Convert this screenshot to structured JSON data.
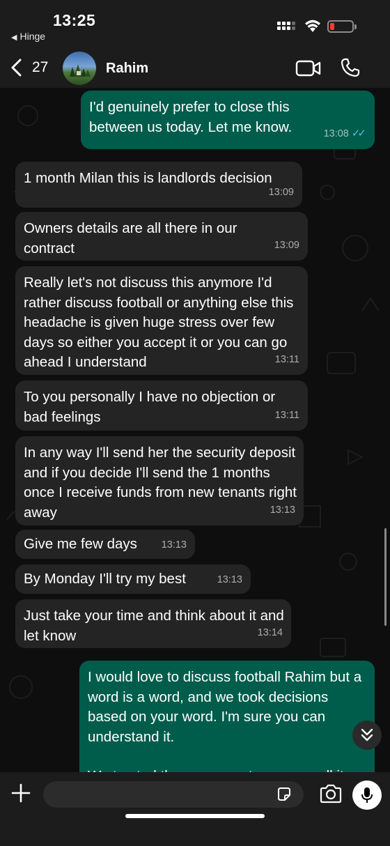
{
  "status_bar": {
    "time": "13:25",
    "back_app": "Hinge"
  },
  "header": {
    "back_count": "27",
    "contact_name": "Rahim"
  },
  "messages": [
    {
      "direction": "out",
      "text": "I'd genuinely prefer to close this between us today. Let me know.",
      "time": "13:08",
      "read": true
    },
    {
      "direction": "in",
      "text": "1 month Milan this is landlords decision",
      "time": "13:09"
    },
    {
      "direction": "in",
      "text": "Owners details are all there in our contract",
      "time": "13:09"
    },
    {
      "direction": "in",
      "text": "Really let's not discuss this anymore I'd rather discuss football or anything else this headache is given huge stress over few days so either you accept it or you can go ahead I understand",
      "time": "13:11"
    },
    {
      "direction": "in",
      "text": "To you personally I have no objection or bad feelings",
      "time": "13:11"
    },
    {
      "direction": "in",
      "text": "In any way I'll send her the security deposit and if you decide I'll send the 1 months once I receive funds from new tenants right away",
      "time": "13:13"
    },
    {
      "direction": "in",
      "text": "Give me few days",
      "time": "13:13"
    },
    {
      "direction": "in",
      "text": "By Monday I'll try my best",
      "time": "13:13"
    },
    {
      "direction": "in",
      "text": "Just take your time and think about it and let know",
      "time": "13:14"
    },
    {
      "direction": "out",
      "text": "I would love to discuss football Rahim but a word is a word, and we took decisions based on your word. I'm sure you can understand it.",
      "text_cutoff": "We trusted the agreement you were all it"
    }
  ],
  "composer": {
    "placeholder": ""
  },
  "colors": {
    "outgoing": "#005c4b",
    "incoming": "#242424",
    "read_tick": "#53bdeb",
    "battery_low": "#ff3b30"
  }
}
